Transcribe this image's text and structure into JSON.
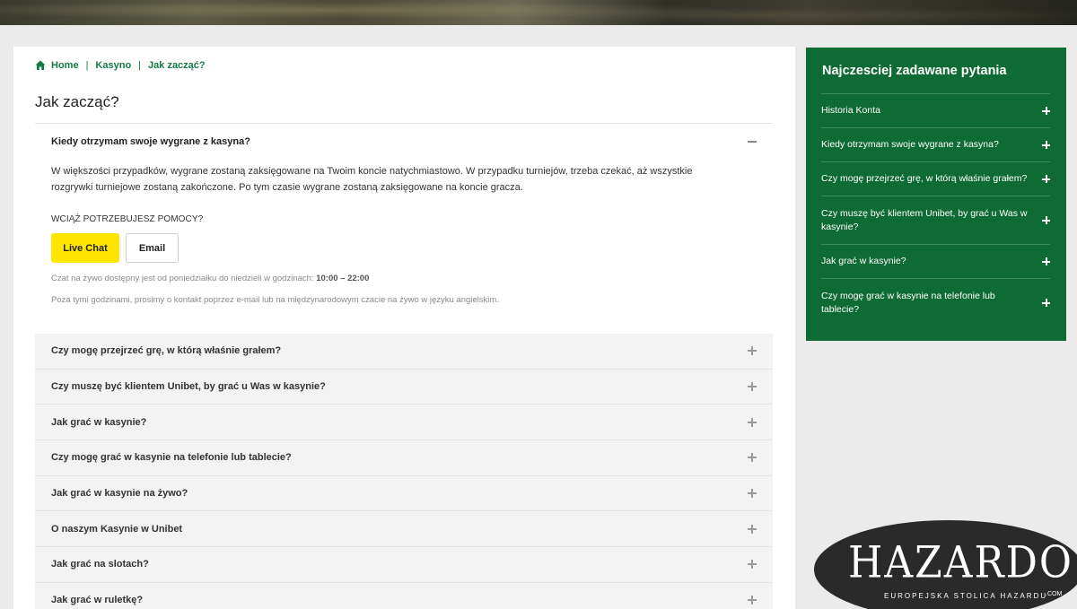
{
  "breadcrumb": {
    "home": "Home",
    "sep1": "|",
    "kasyno": "Kasyno",
    "sep2": "|",
    "current": "Jak zacząć?"
  },
  "page_title": "Jak zacząć?",
  "open_item": {
    "question": "Kiedy otrzymam swoje wygrane z kasyna?",
    "answer": "W większości przypadków, wygrane zostaną zaksięgowane na Twoim koncie natychmiastowo. W przypadku turniejów, trzeba czekać, aż wszystkie rozgrywki turniejowe zostaną zakończone. Po tym czasie wygrane zostaną zaksięgowane na koncie gracza.",
    "help_title": "WCIĄŻ POTRZEBUJESZ POMOCY?",
    "live_chat": "Live Chat",
    "email": "Email",
    "chat_hours_text": "Czat na żywo dostępny jest od poniedziałku do niedzieli w godzinach: ",
    "chat_hours": "10:00 – 22:00",
    "outside_hours": "Poza tymi godzinami, prosimy o kontakt poprzez e-mail lub na międzynarodowym czacie na żywo w języku angielskim."
  },
  "faq": [
    "Czy mogę przejrzeć grę, w którą właśnie grałem?",
    "Czy muszę być klientem Unibet, by grać u Was w kasynie?",
    "Jak grać w kasynie?",
    "Czy mogę grać w kasynie na telefonie lub tablecie?",
    "Jak grać w kasynie na żywo?",
    "O naszym Kasynie w Unibet",
    "Jak grać na slotach?",
    "Jak grać w ruletkę?"
  ],
  "sidebar": {
    "title": "Najczesciej zadawane pytania",
    "items": [
      "Historia Konta",
      "Kiedy otrzymam swoje wygrane z kasyna?",
      "Czy mogę przejrzeć grę, w którą właśnie grałem?",
      "Czy muszę być klientem Unibet, by grać u Was w kasynie?",
      "Jak grać w kasynie?",
      "Czy mogę grać w kasynie na telefonie lub tablecie?"
    ]
  },
  "watermark": {
    "brand": "HAZARDOWO",
    "tagline": "EUROPEJSKA STOLICA HAZARDU",
    "tld": ".COM"
  },
  "colors": {
    "brand_green": "#0f6b34",
    "link_green": "#147b45",
    "chat_yellow": "#ffe500"
  }
}
